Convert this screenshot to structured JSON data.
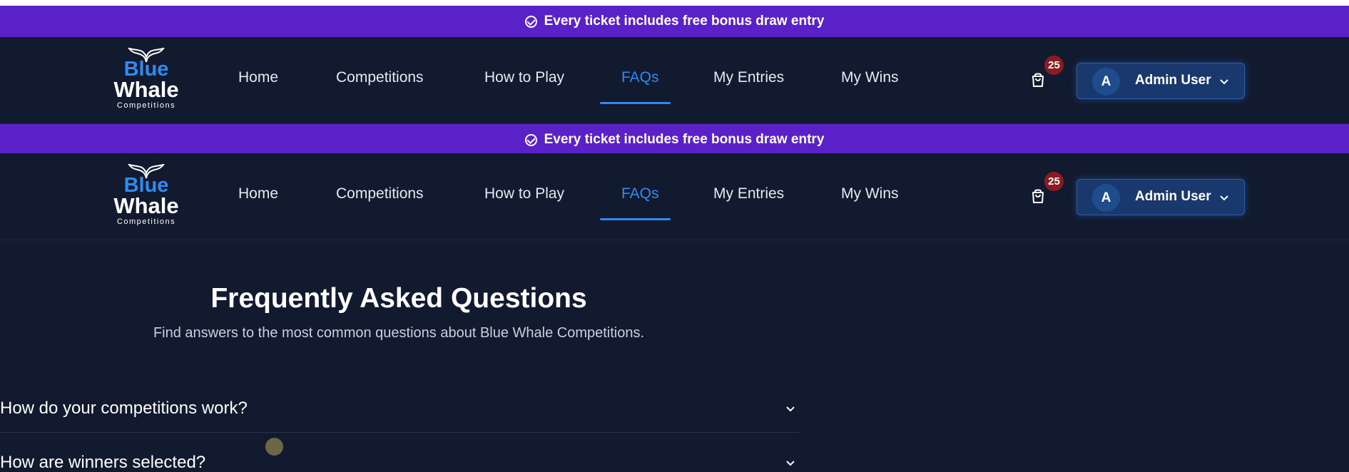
{
  "promo_banner": {
    "text": "Every ticket includes free bonus draw entry"
  },
  "logo": {
    "line1": "Blue",
    "line2": "Whale",
    "line3": "Competitions"
  },
  "nav": {
    "items": [
      {
        "label": "Home"
      },
      {
        "label": "Competitions"
      },
      {
        "label": "How to Play"
      },
      {
        "label": "FAQs",
        "active": true
      },
      {
        "label": "My Entries"
      },
      {
        "label": "My Wins"
      }
    ],
    "cart_count": "25",
    "user": {
      "initial": "A",
      "name": "Admin User"
    }
  },
  "faq": {
    "title": "Frequently Asked Questions",
    "subtitle": "Find answers to the most common questions about Blue Whale Competitions.",
    "questions": [
      {
        "question": "How do your competitions work?"
      },
      {
        "question": "How are winners selected?"
      }
    ]
  },
  "colors": {
    "background": "#111a2e",
    "banner": "#5b21c9",
    "accent": "#2f8bf0",
    "badge": "#8b1b22",
    "user_button": "#19386d"
  },
  "icons": [
    "check-circle-icon",
    "whale-tail-icon",
    "shopping-bag-icon",
    "chevron-down-icon"
  ]
}
